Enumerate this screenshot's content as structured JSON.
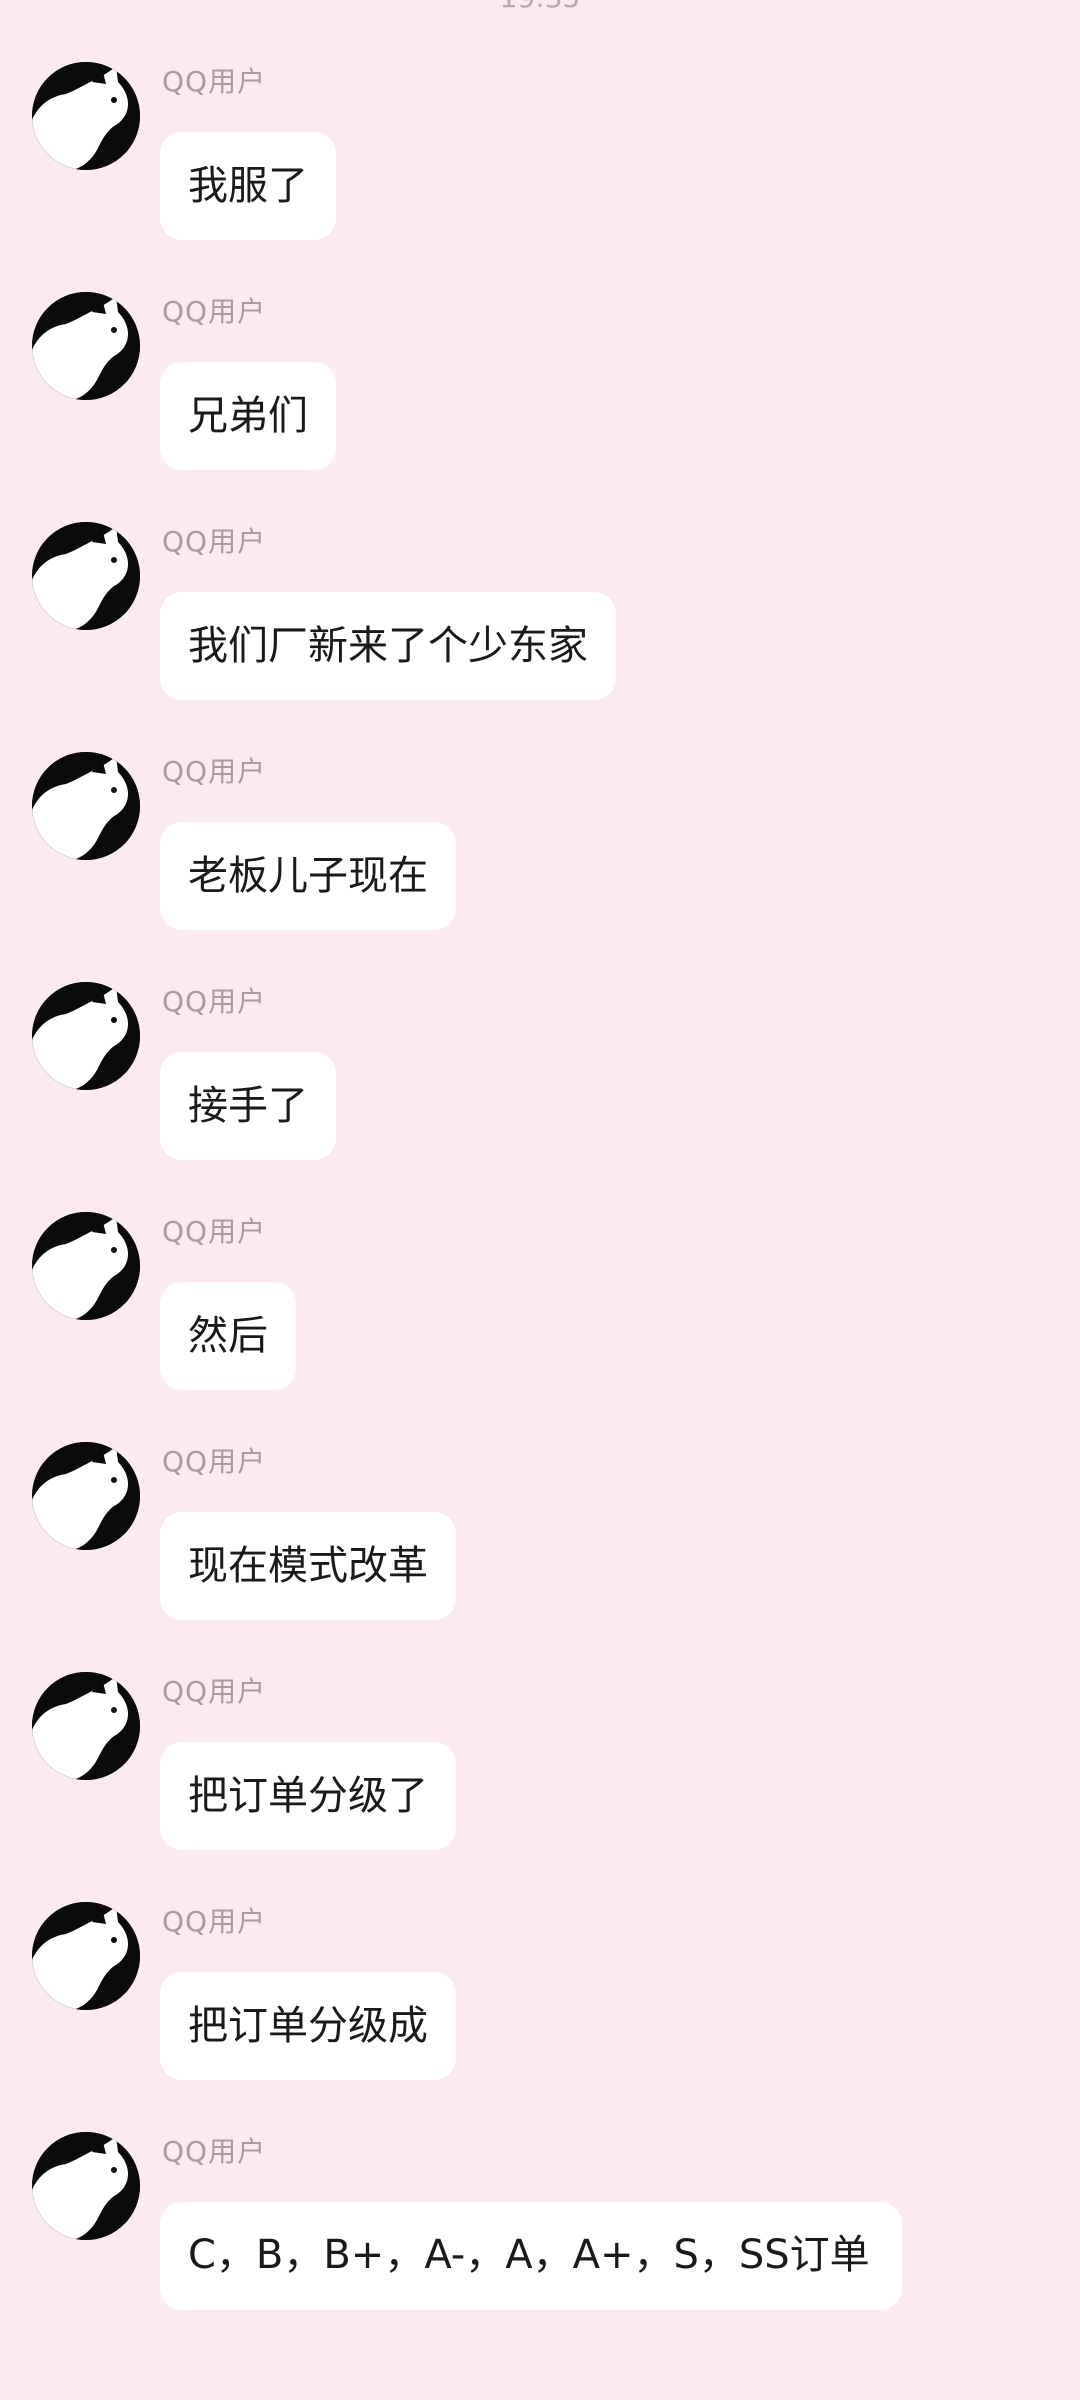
{
  "header": {
    "time_partial": "19:35"
  },
  "messages": [
    {
      "username": "QQ用户",
      "text": "我服了"
    },
    {
      "username": "QQ用户",
      "text": "兄弟们"
    },
    {
      "username": "QQ用户",
      "text": "我们厂新来了个少东家"
    },
    {
      "username": "QQ用户",
      "text": "老板儿子现在"
    },
    {
      "username": "QQ用户",
      "text": "接手了"
    },
    {
      "username": "QQ用户",
      "text": "然后"
    },
    {
      "username": "QQ用户",
      "text": "现在模式改革"
    },
    {
      "username": "QQ用户",
      "text": "把订单分级了"
    },
    {
      "username": "QQ用户",
      "text": "把订单分级成"
    },
    {
      "username": "QQ用户",
      "text": "C，B，B+，A-，A，A+，S，SS订单"
    }
  ],
  "colors": {
    "background": "#fbeaf1",
    "bubble": "#ffffff",
    "username": "#a99ba2",
    "text": "#1a1a1a",
    "avatar": "#0b0b0b"
  },
  "icons": {
    "avatar": "black-cat-silhouette-icon"
  }
}
